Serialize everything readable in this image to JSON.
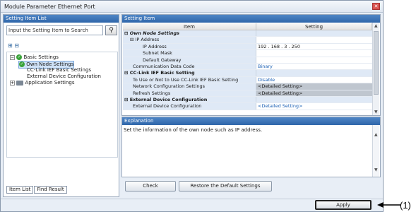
{
  "window": {
    "title": "Module Parameter Ethernet Port"
  },
  "left_panel": {
    "header": "Setting Item List",
    "search_placeholder": "Input the Setting Item to Search",
    "tree": [
      {
        "label": "Basic Settings",
        "level": 0
      },
      {
        "label": "Own Node Settings",
        "level": 1
      },
      {
        "label": "CC-Link IEF Basic Settings",
        "level": 2
      },
      {
        "label": "External Device Configuration",
        "level": 2
      },
      {
        "label": "Application Settings",
        "level": 0
      }
    ],
    "tabs": [
      "Item List",
      "Find Result"
    ]
  },
  "right_panel": {
    "header": "Setting Item",
    "columns": [
      "Item",
      "Setting"
    ],
    "rows": [
      {
        "item": "Own Node Settings",
        "setting": ""
      },
      {
        "item": "IP Address",
        "setting": ""
      },
      {
        "item": "IP Address",
        "setting": "192 . 168 . 3 . 250"
      },
      {
        "item": "Subnet Mask",
        "setting": ""
      },
      {
        "item": "Default Gateway",
        "setting": ""
      },
      {
        "item": "Communication Data Code",
        "setting": "Binary"
      },
      {
        "item": "CC-Link IEF Basic Setting",
        "setting": ""
      },
      {
        "item": "To Use or Not to Use CC-Link IEF Basic Setting",
        "setting": "Disable"
      },
      {
        "item": "Network Configuration Settings",
        "setting": "<Detailed Setting>"
      },
      {
        "item": "Refresh Settings",
        "setting": "<Detailed Setting>"
      },
      {
        "item": "External Device Configuration",
        "setting": ""
      },
      {
        "item": "External Device Configuration",
        "setting": "<Detailed Setting>"
      }
    ]
  },
  "explanation": {
    "header": "Explanation",
    "text": "Set the information of the own node such as IP address."
  },
  "buttons": {
    "check": "Check",
    "restore": "Restore the Default Settings",
    "apply": "Apply"
  },
  "callout": "(1)"
}
